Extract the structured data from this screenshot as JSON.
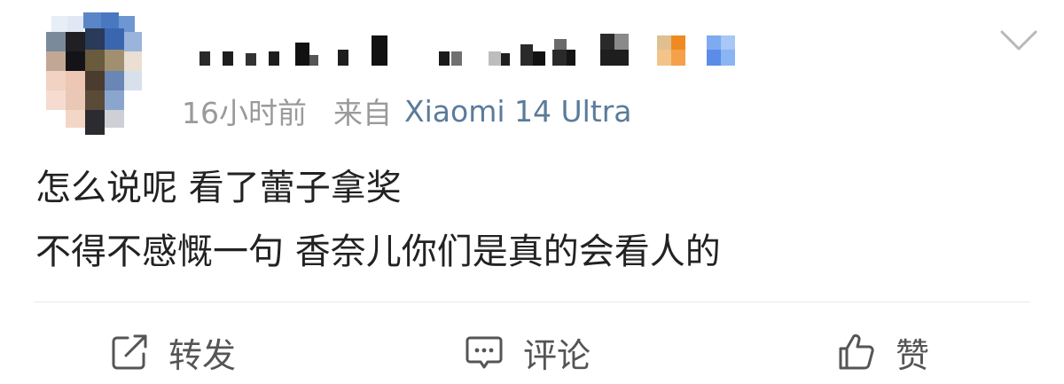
{
  "post": {
    "time": "16小时前",
    "source_prefix": "来自",
    "device": "Xiaomi 14 Ultra",
    "content_lines": [
      "怎么说呢 看了蕾子拿奖",
      "不得不感慨一句 香奈儿你们是真的会看人的"
    ]
  },
  "actions": {
    "repost_label": "转发",
    "comment_label": "评论",
    "like_label": "赞"
  },
  "icons": {
    "menu": "chevron-down-icon",
    "repost": "share-icon",
    "comment": "comment-icon",
    "like": "thumbs-up-icon"
  },
  "colors": {
    "device_link": "#5b7b9a",
    "meta_gray": "#9a9a9a",
    "text": "#222222",
    "action_gray": "#555555"
  }
}
